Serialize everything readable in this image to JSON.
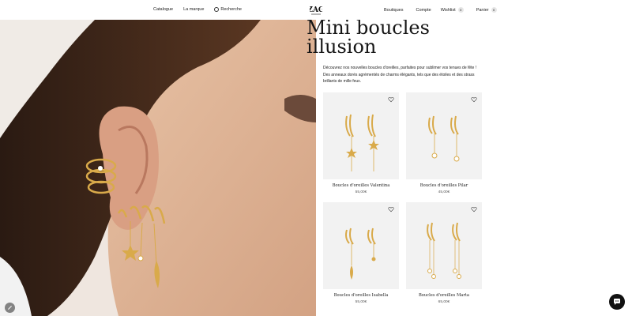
{
  "header": {
    "nav_left": {
      "catalogue": "Catalogue",
      "brand": "La marque",
      "search": "Recherche"
    },
    "logo_text": "ZAG",
    "nav_right": {
      "shops": "Boutiques",
      "account": "Compte",
      "wishlist": "Wishlist",
      "wishlist_count": "0",
      "cart": "Panier",
      "cart_count": "0"
    }
  },
  "collection": {
    "title_line1": "Mini boucles",
    "title_line2": "illusion",
    "description": "Découvrez nos nouvelles boucles d'oreilles, parfaites pour sublimer vos tenues de fête ! Des anneaux dorés agrémentés de charms élégants, tels que des étoiles et des strass brillants de mille feux."
  },
  "products": [
    {
      "name": "Boucles d'oreilles Valentina",
      "price": "55,00€"
    },
    {
      "name": "Boucles d'oreilles Pilar",
      "price": "45,00€"
    },
    {
      "name": "Boucles d'oreilles Isabella",
      "price": "55,00€"
    },
    {
      "name": "Boucles d'oreilles Marta",
      "price": "65,00€"
    }
  ],
  "colors": {
    "gold": "#d9aa4a",
    "card_bg": "#f2f2f2",
    "text": "#1a1a1a"
  },
  "icons": {
    "search": "search-icon",
    "heart": "heart-icon",
    "chat": "chat-icon"
  }
}
